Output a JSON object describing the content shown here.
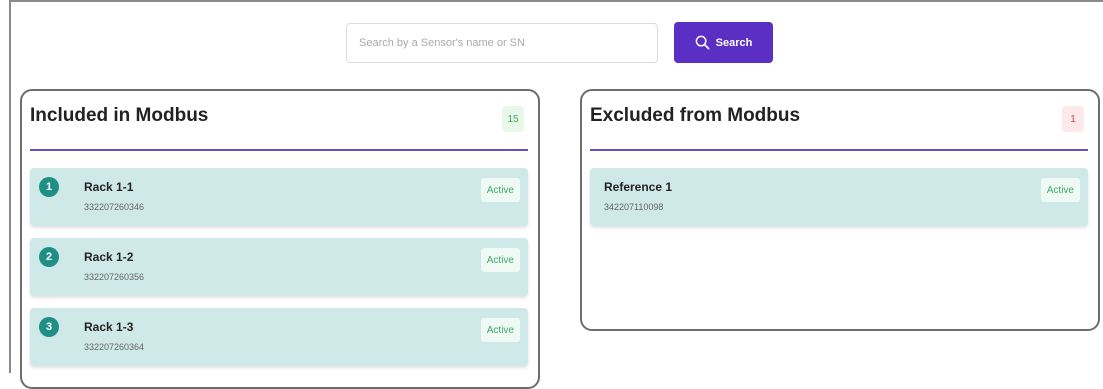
{
  "search": {
    "placeholder": "Search by a Sensor's name or SN",
    "button_label": "Search"
  },
  "included": {
    "title": "Included in Modbus",
    "count": "15",
    "sensors": [
      {
        "index": "1",
        "name": "Rack 1-1",
        "sn": "332207260346",
        "status": "Active"
      },
      {
        "index": "2",
        "name": "Rack 1-2",
        "sn": "332207260356",
        "status": "Active"
      },
      {
        "index": "3",
        "name": "Rack 1-3",
        "sn": "332207260364",
        "status": "Active"
      }
    ]
  },
  "excluded": {
    "title": "Excluded from Modbus",
    "count": "1",
    "sensors": [
      {
        "name": "Reference 1",
        "sn": "342207110098",
        "status": "Active"
      }
    ]
  },
  "colors": {
    "accent": "#5b2fc4",
    "card_bg": "#cfe9e8",
    "index_circle": "#1f8f86",
    "status_green": "#3fa86a",
    "count_red": "#d0454f"
  },
  "icons": {
    "search_button": "search-icon"
  }
}
